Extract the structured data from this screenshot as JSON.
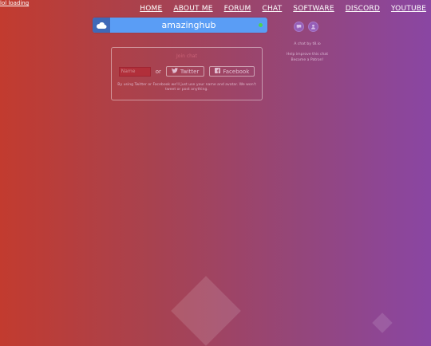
{
  "loading_text": "lol loading",
  "nav": {
    "items": [
      {
        "label": "HOME",
        "name": "nav-home"
      },
      {
        "label": "ABOUT ME",
        "name": "nav-about-me"
      },
      {
        "label": "FORUM",
        "name": "nav-forum"
      },
      {
        "label": "CHAT",
        "name": "nav-chat"
      },
      {
        "label": "SOFTWARE",
        "name": "nav-software"
      },
      {
        "label": "DISCORD",
        "name": "nav-discord"
      },
      {
        "label": "YOUTUBE",
        "name": "nav-youtube"
      }
    ]
  },
  "chat": {
    "title": "amazinghub",
    "icon": "cloud-icon",
    "status_color": "#4ed34e"
  },
  "login": {
    "heading": "Join chat",
    "name_placeholder": "Name",
    "or_text": "or",
    "twitter_label": "Twitter",
    "facebook_label": "Facebook",
    "note": "By using Twitter or Facebook we'll just use your name and avatar. We won't tweet or post anything."
  },
  "sidebar": {
    "icons": [
      "chat-bubble-icon",
      "user-icon"
    ],
    "credit": "A chat by t8.io",
    "support_line1": "Help improve this chat",
    "support_line2": "Become a Patron!"
  },
  "colors": {
    "chatbar": "#5a9df5",
    "chatbar_icon_bg": "#3f69b8",
    "gradient_left": "#c23b2f",
    "gradient_right": "#8a46a3"
  }
}
